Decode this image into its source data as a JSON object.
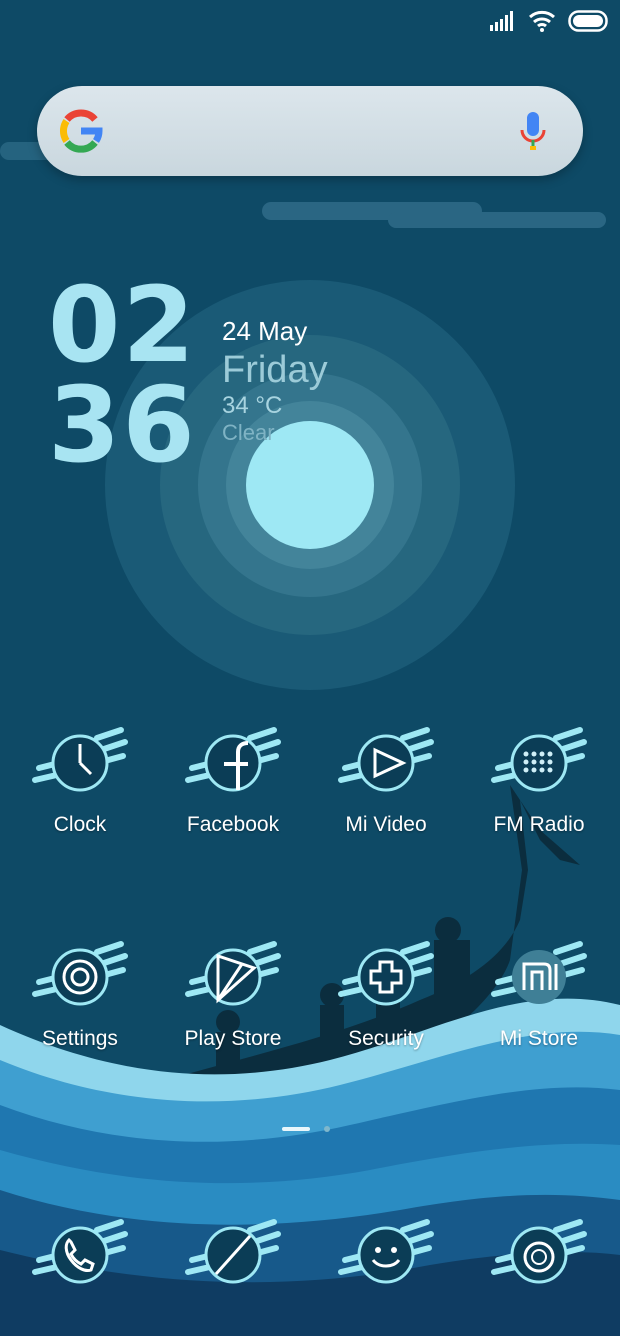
{
  "status": {
    "signal_icon": "signal-icon",
    "wifi_icon": "wifi-icon",
    "battery_icon": "battery-icon"
  },
  "search": {
    "logo_icon": "google-logo-icon",
    "mic_icon": "mic-icon"
  },
  "clock": {
    "hours": "02",
    "minutes": "36"
  },
  "date": {
    "day_month": "24 May",
    "weekday": "Friday",
    "temperature": "34 °C",
    "condition": "Clear"
  },
  "apps_row1": [
    {
      "label": "Clock",
      "icon": "clock-icon"
    },
    {
      "label": "Facebook",
      "icon": "facebook-icon"
    },
    {
      "label": "Mi Video",
      "icon": "video-play-icon"
    },
    {
      "label": "FM Radio",
      "icon": "radio-icon"
    }
  ],
  "apps_row2": [
    {
      "label": "Settings",
      "icon": "settings-icon"
    },
    {
      "label": "Play Store",
      "icon": "play-store-icon"
    },
    {
      "label": "Security",
      "icon": "security-icon"
    },
    {
      "label": "Mi Store",
      "icon": "mi-store-icon"
    }
  ],
  "dock": [
    {
      "icon": "phone-icon"
    },
    {
      "icon": "browser-icon"
    },
    {
      "icon": "messages-icon"
    },
    {
      "icon": "camera-icon"
    }
  ],
  "page_indicator": {
    "pages": 2,
    "current": 1
  },
  "colors": {
    "background": "#0e4a66",
    "accent": "#9ee8f4",
    "clock": "#a8e4f2"
  }
}
